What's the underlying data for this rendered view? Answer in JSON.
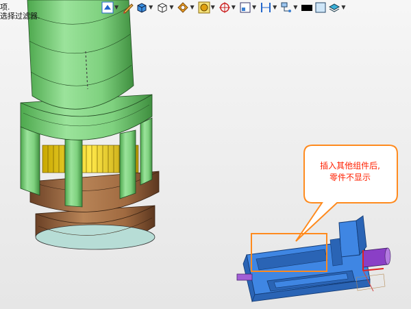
{
  "hints": {
    "line1": "项.",
    "line2": "选择过滤器."
  },
  "toolbar": {
    "buttons": [
      {
        "name": "view-orient-icon",
        "dropdown": true
      },
      {
        "name": "sketch-pencil-icon",
        "dropdown": false
      },
      {
        "name": "shaded-solid-icon",
        "dropdown": true
      },
      {
        "name": "wireframe-cube-icon",
        "dropdown": true
      },
      {
        "name": "section-view-icon",
        "dropdown": true
      },
      {
        "name": "render-sphere-icon",
        "dropdown": true
      },
      {
        "name": "snap-target-icon",
        "dropdown": true
      },
      {
        "name": "grid-view-icon",
        "dropdown": true
      },
      {
        "name": "dimension-icon",
        "dropdown": true
      },
      {
        "name": "display-filter-icon",
        "dropdown": true
      },
      {
        "name": "color-black-swatch",
        "dropdown": false
      },
      {
        "name": "color-light-swatch",
        "dropdown": false
      },
      {
        "name": "appearance-layers-icon",
        "dropdown": true
      }
    ]
  },
  "callout": {
    "line1": "插入其他组件后,",
    "line2": "零件不显示"
  },
  "colors": {
    "part_green": "#7fd17f",
    "part_brown": "#a9754a",
    "vise_blue": "#3f86e3",
    "callout_border": "#ff8a1d",
    "callout_text": "#ff2000"
  }
}
